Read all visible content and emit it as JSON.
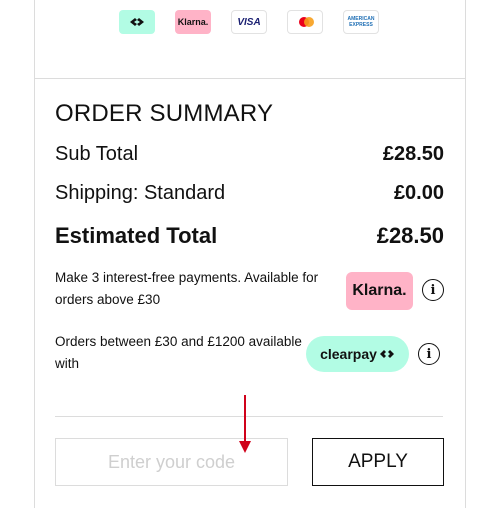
{
  "payment_icons": {
    "clearpay": "clearpay-icon",
    "klarna_label": "Klarna.",
    "visa_label": "VISA",
    "mastercard": "mastercard-icon",
    "amex_line1": "AMERICAN",
    "amex_line2": "EXPRESS"
  },
  "summary": {
    "title": "ORDER SUMMARY",
    "rows": [
      {
        "label": "Sub Total",
        "value": "£28.50"
      },
      {
        "label": "Shipping: Standard",
        "value": "£0.00"
      },
      {
        "label": "Estimated Total",
        "value": "£28.50"
      }
    ]
  },
  "klarna": {
    "text": "Make 3 interest-free payments. Available for orders above £30",
    "badge_label": "Klarna."
  },
  "clearpay": {
    "text": "Orders between £30 and £1200 available with",
    "badge_label": "clearpay"
  },
  "promo": {
    "placeholder": "Enter your code",
    "apply_label": "APPLY"
  },
  "colors": {
    "klarna_pink": "#ffb3c7",
    "clearpay_mint": "#b2fce4",
    "annotation_arrow": "#d0021b"
  }
}
